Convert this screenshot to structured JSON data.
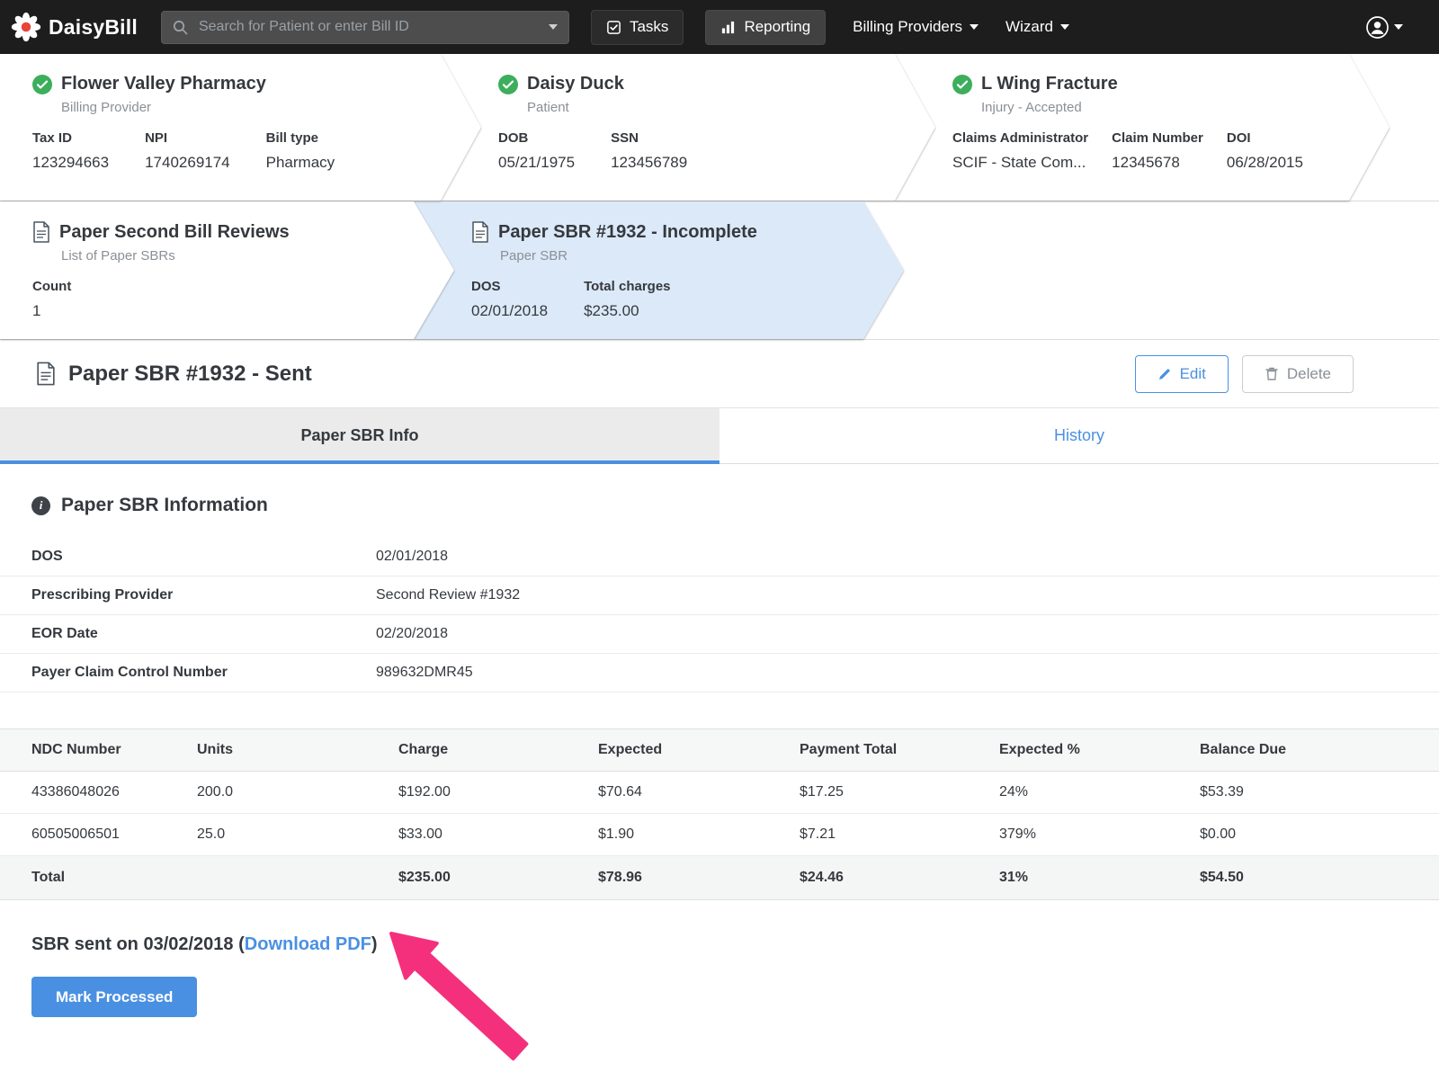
{
  "colors": {
    "accent-blue": "#4a90e2",
    "success-green": "#3dae5b",
    "annotation-pink": "#f4307c",
    "active-card-bg": "#dce9f8",
    "navbar-bg": "#1d1d1d"
  },
  "navbar": {
    "brand": "DaisyBill",
    "search": {
      "placeholder": "Search for Patient or enter Bill ID",
      "value": ""
    },
    "tasks_label": "Tasks",
    "reporting_label": "Reporting",
    "billing_providers_label": "Billing Providers",
    "wizard_label": "Wizard"
  },
  "cards": {
    "provider": {
      "title": "Flower Valley Pharmacy",
      "subtitle": "Billing Provider",
      "fields": [
        {
          "label": "Tax ID",
          "value": "123294663"
        },
        {
          "label": "NPI",
          "value": "1740269174"
        },
        {
          "label": "Bill type",
          "value": "Pharmacy"
        }
      ]
    },
    "patient": {
      "title": "Daisy Duck",
      "subtitle": "Patient",
      "fields": [
        {
          "label": "DOB",
          "value": "05/21/1975"
        },
        {
          "label": "SSN",
          "value": "123456789"
        }
      ]
    },
    "injury": {
      "title": "L Wing Fracture",
      "subtitle": "Injury - Accepted",
      "fields": [
        {
          "label": "Claims Administrator",
          "value": "SCIF - State Com..."
        },
        {
          "label": "Claim Number",
          "value": "12345678"
        },
        {
          "label": "DOI",
          "value": "06/28/2015"
        }
      ]
    },
    "sbr_list": {
      "title": "Paper Second Bill Reviews",
      "subtitle": "List of Paper SBRs",
      "fields": [
        {
          "label": "Count",
          "value": "1"
        }
      ]
    },
    "sbr_current": {
      "title": "Paper SBR #1932 - Incomplete",
      "subtitle": "Paper SBR",
      "fields": [
        {
          "label": "DOS",
          "value": "02/01/2018"
        },
        {
          "label": "Total charges",
          "value": "$235.00"
        }
      ]
    }
  },
  "detail": {
    "title": "Paper SBR #1932 - Sent",
    "edit_label": "Edit",
    "delete_label": "Delete",
    "tabs": {
      "info": "Paper SBR Info",
      "history": "History"
    },
    "section_heading": "Paper SBR Information",
    "fields": [
      {
        "label": "DOS",
        "value": "02/01/2018"
      },
      {
        "label": "Prescribing Provider",
        "value": "Second Review #1932"
      },
      {
        "label": "EOR Date",
        "value": "02/20/2018"
      },
      {
        "label": "Payer Claim Control Number",
        "value": "989632DMR45"
      }
    ],
    "table": {
      "headers": [
        "NDC Number",
        "Units",
        "Charge",
        "Expected",
        "Payment Total",
        "Expected %",
        "Balance Due"
      ],
      "rows": [
        [
          "43386048026",
          "200.0",
          "$192.00",
          "$70.64",
          "$17.25",
          "24%",
          "$53.39"
        ],
        [
          "60505006501",
          "25.0",
          "$33.00",
          "$1.90",
          "$7.21",
          "379%",
          "$0.00"
        ]
      ],
      "total_row": [
        "Total",
        "",
        "$235.00",
        "$78.96",
        "$24.46",
        "31%",
        "$54.50"
      ]
    },
    "sent_prefix": "SBR sent on 03/02/2018 (",
    "download_link": "Download PDF",
    "sent_suffix": ")",
    "mark_processed_label": "Mark Processed"
  }
}
